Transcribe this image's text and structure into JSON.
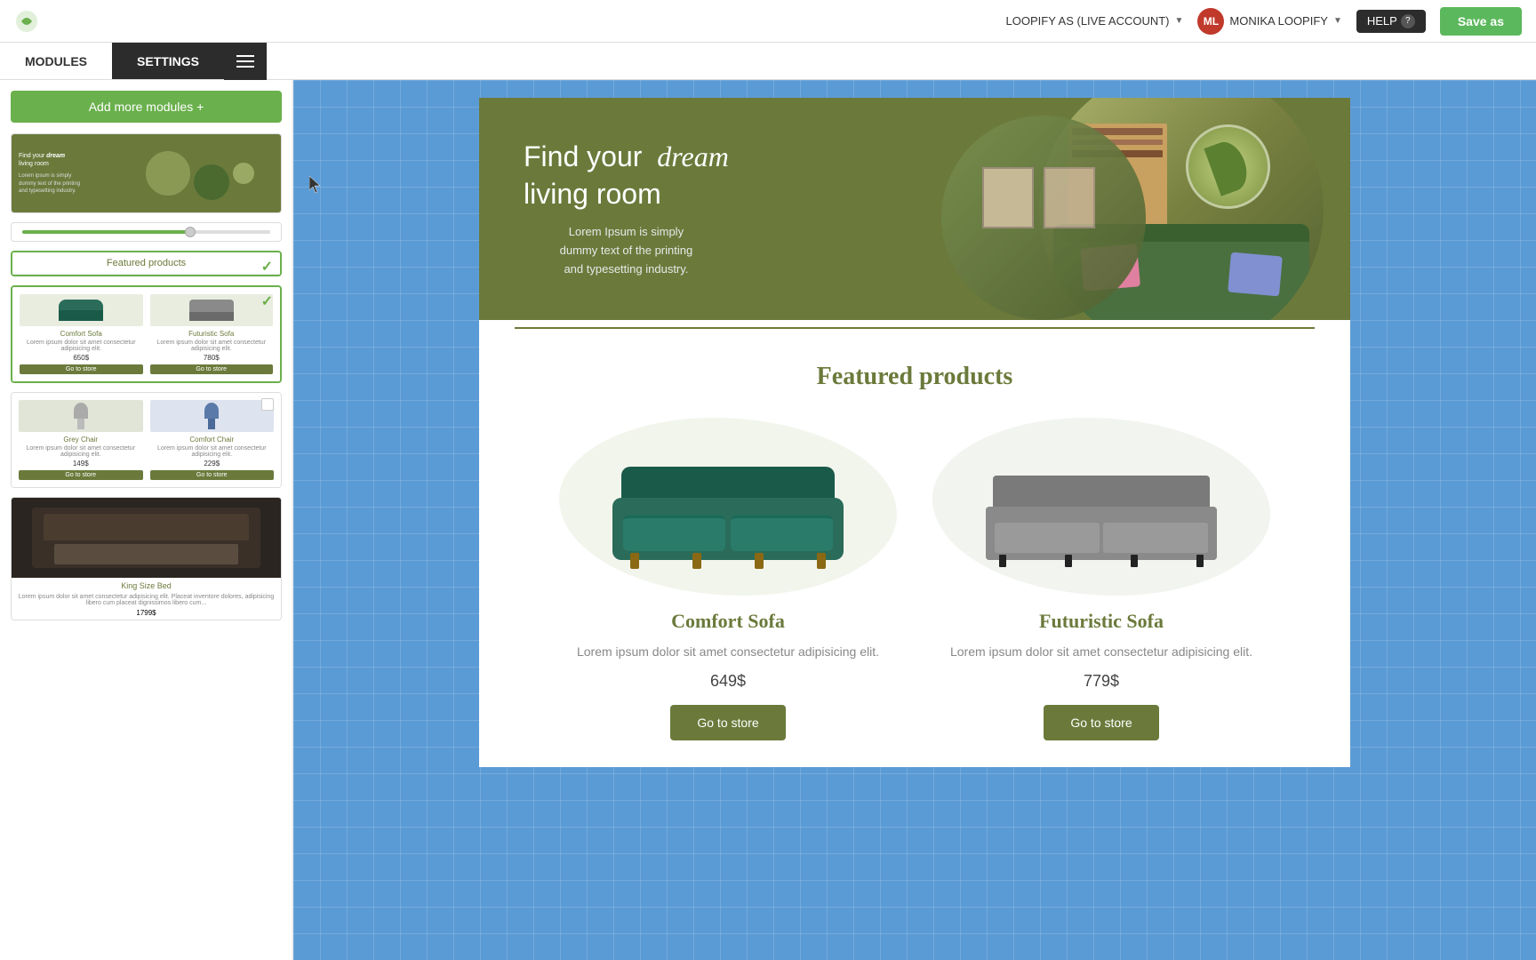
{
  "topbar": {
    "account_label": "LOOPIFY AS (LIVE ACCOUNT)",
    "user_label": "MONIKA LOOPIFY",
    "help_label": "HELP",
    "save_as_label": "Save as",
    "avatar_initials": "ML"
  },
  "nav": {
    "modules_label": "MODULES",
    "settings_label": "SETTINGS"
  },
  "sidebar": {
    "add_modules_label": "Add more modules +",
    "featured_label": "Featured products"
  },
  "canvas": {
    "hero": {
      "title_line1": "Find your",
      "title_line2_italic": "dream",
      "title_line3": "living room",
      "subtitle": "Lorem Ipsum is simply\ndummy text of the printing\nand typesetting industry."
    },
    "featured": {
      "title": "Featured products",
      "products": [
        {
          "name": "Comfort Sofa",
          "description": "Lorem ipsum dolor sit amet consectetur adipisicing elit.",
          "price": "649$",
          "btn_label": "Go to store"
        },
        {
          "name": "Futuristic Sofa",
          "description": "Lorem ipsum dolor sit amet consectetur adipisicing elit.",
          "price": "779$",
          "btn_label": "Go to store"
        }
      ]
    }
  },
  "sidebar_modules": [
    {
      "type": "banner",
      "label": "Banner module"
    },
    {
      "type": "slider",
      "label": "Slider module"
    },
    {
      "type": "featured_products",
      "label": "Featured products"
    },
    {
      "type": "sofa_products",
      "label": "Sofa products",
      "selected": true
    },
    {
      "type": "chair_products",
      "label": "Chair products"
    },
    {
      "type": "bed_product",
      "label": "King Size Bed",
      "price": "1799$",
      "description": "Lorem ipsum dolor sit amet consectetur adipisicing elit. Placeat inventore dolores, adipisicing libero cum placeat dignissimos libero cum..."
    }
  ]
}
